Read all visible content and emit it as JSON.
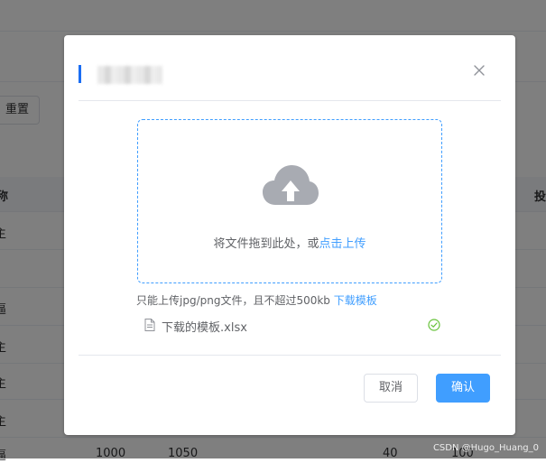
{
  "background": {
    "reset_button": "重置",
    "header_left": "称",
    "header_right": "投",
    "row_labels": [
      "主",
      "",
      "逼",
      "主",
      "主",
      "主",
      "逼"
    ],
    "bottom_values": [
      "1000",
      "1050",
      "40",
      "100"
    ]
  },
  "watermark": "CSDN @Hugo_Huang_0",
  "dialog": {
    "title": "",
    "upload": {
      "drag_text": "将文件拖到此处，或",
      "click_text": "点击上传",
      "tip_text": "只能上传jpg/png文件，且不超过500kb",
      "template_link": "下载模板"
    },
    "file": {
      "name": "下载的模板.xlsx",
      "status": "success"
    },
    "buttons": {
      "cancel": "取消",
      "confirm": "确认"
    }
  },
  "colors": {
    "primary": "#409eff",
    "title_accent": "#1b6ef3",
    "success": "#67c23a",
    "icon_gray": "#a8abb2"
  },
  "icons": {
    "close": "close-icon",
    "upload": "upload-cloud-icon",
    "file": "document-icon",
    "success": "circle-check-icon"
  }
}
